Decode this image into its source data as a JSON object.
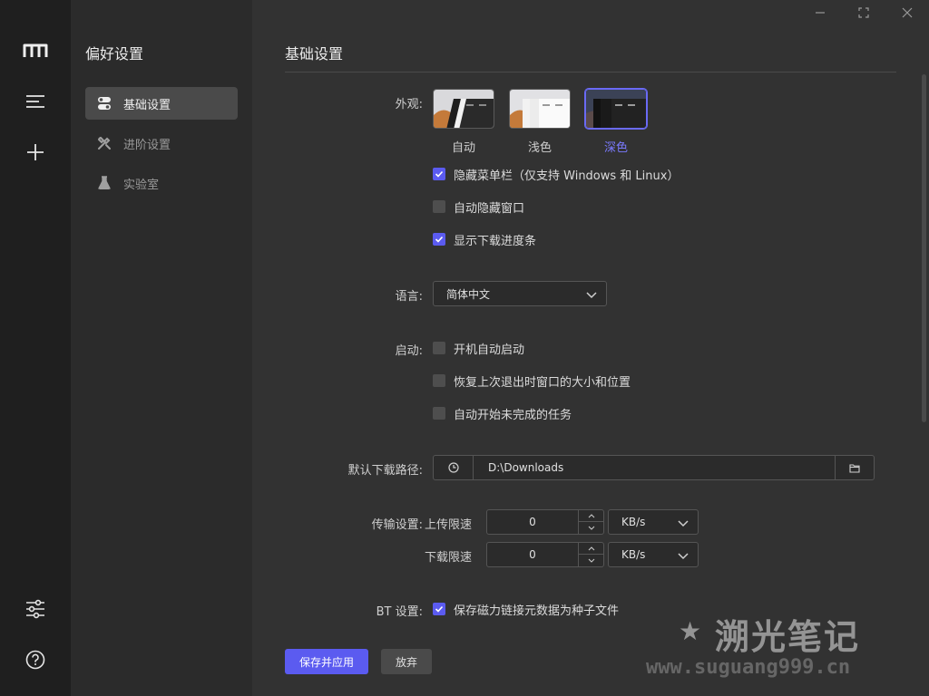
{
  "sidebar": {
    "title": "偏好设置",
    "items": [
      {
        "label": "基础设置",
        "icon": "toggle-icon",
        "active": true
      },
      {
        "label": "进阶设置",
        "icon": "tools-icon",
        "active": false
      },
      {
        "label": "实验室",
        "icon": "lab-icon",
        "active": false
      }
    ]
  },
  "rail": {
    "icons": [
      "logo-icon",
      "menu-icon",
      "plus-icon",
      "sliders-icon",
      "help-icon"
    ]
  },
  "main": {
    "title": "基础设置",
    "appearance": {
      "label": "外观:",
      "themes": [
        {
          "name": "自动",
          "selected": false
        },
        {
          "name": "浅色",
          "selected": false
        },
        {
          "name": "深色",
          "selected": true
        }
      ],
      "options": [
        {
          "label": "隐藏菜单栏（仅支持 Windows 和 Linux）",
          "checked": true
        },
        {
          "label": "自动隐藏窗口",
          "checked": false
        },
        {
          "label": "显示下载进度条",
          "checked": true
        }
      ]
    },
    "language": {
      "label": "语言:",
      "value": "简体中文"
    },
    "startup": {
      "label": "启动:",
      "options": [
        {
          "label": "开机自动启动",
          "checked": false
        },
        {
          "label": "恢复上次退出时窗口的大小和位置",
          "checked": false
        },
        {
          "label": "自动开始未完成的任务",
          "checked": false
        }
      ]
    },
    "download_path": {
      "label": "默认下载路径:",
      "value": "D:\\Downloads"
    },
    "transfer": {
      "label": "传输设置:",
      "upload_label": "上传限速",
      "upload_value": "0",
      "upload_unit": "KB/s",
      "download_label": "下载限速",
      "download_value": "0",
      "download_unit": "KB/s"
    },
    "bt": {
      "label": "BT 设置:",
      "option": "保存磁力链接元数据为种子文件",
      "checked": true
    },
    "buttons": {
      "save": "保存并应用",
      "discard": "放弃"
    }
  },
  "watermark": {
    "title": "溯光笔记",
    "url": "www.suguang999.cn"
  },
  "colors": {
    "accent": "#5b5bf0",
    "selected_text": "#7b7bff",
    "rail_bg": "#1f1f1f",
    "sidebar_bg": "#2b2b2b",
    "main_bg": "#323232"
  }
}
